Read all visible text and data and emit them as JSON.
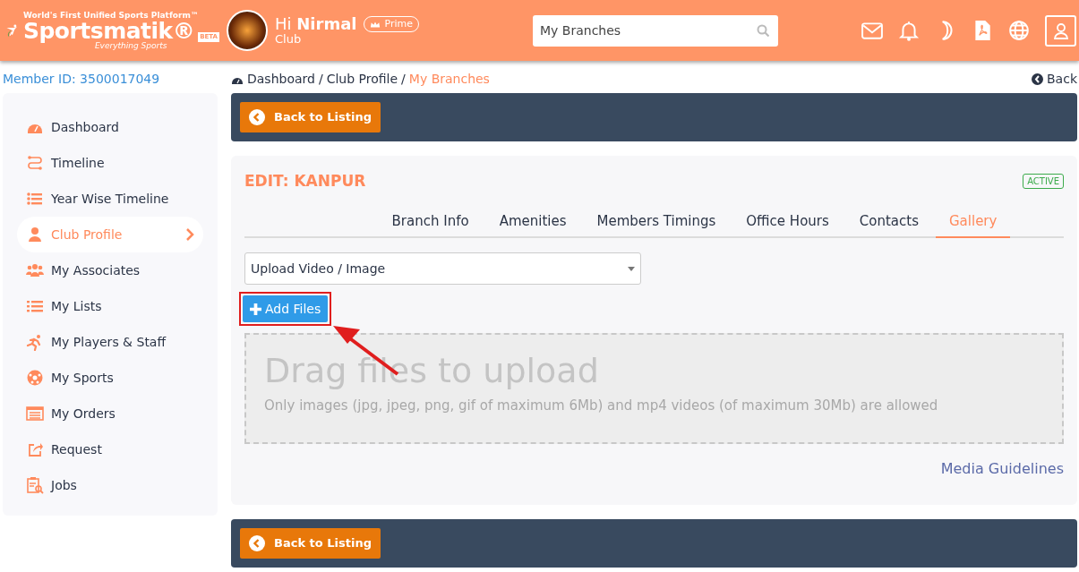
{
  "header": {
    "logo": {
      "tagline_top": "World's First Unified Sports Platform™",
      "brand": "Sportsmatik®",
      "beta": "BETA",
      "tagline_bottom": "Everything Sports"
    },
    "greeting": "Hi **Nirmal**",
    "badge": "Prime",
    "role": "Club",
    "search": {
      "value": "My Branches"
    }
  },
  "member_id": "Member ID: 3500017049",
  "breadcrumb": {
    "separator": "/",
    "items": [
      {
        "label": "Dashboard",
        "current": false
      },
      {
        "label": "Club Profile",
        "current": false
      },
      {
        "label": "My Branches",
        "current": true
      }
    ]
  },
  "back": "Back",
  "sidebar": {
    "items": [
      {
        "label": "Dashboard",
        "selected": false
      },
      {
        "label": "Timeline",
        "selected": false
      },
      {
        "label": "Year Wise Timeline",
        "selected": false
      },
      {
        "label": "Club Profile",
        "selected": true
      },
      {
        "label": "My Associates",
        "selected": false
      },
      {
        "label": "My Lists",
        "selected": false
      },
      {
        "label": "My Players & Staff",
        "selected": false
      },
      {
        "label": "My Sports",
        "selected": false
      },
      {
        "label": "My Orders",
        "selected": false
      },
      {
        "label": "Request",
        "selected": false
      },
      {
        "label": "Jobs",
        "selected": false
      }
    ]
  },
  "top_bar": {
    "button": "Back to Listing"
  },
  "edit_card": {
    "title": "EDIT: KANPUR",
    "status": "ACTIVE",
    "tabs": [
      {
        "label": "Branch Info",
        "selected": false
      },
      {
        "label": "Amenities",
        "selected": false
      },
      {
        "label": "Members Timings",
        "selected": false
      },
      {
        "label": "Office Hours",
        "selected": false
      },
      {
        "label": "Contacts",
        "selected": false
      },
      {
        "label": "Gallery",
        "selected": true
      }
    ],
    "select": {
      "value": "Upload Video / Image"
    },
    "add_button": "Add Files",
    "dropzone": {
      "title": "Drag files to upload",
      "hint": "Only images (jpg, jpeg, png, gif of maximum 6Mb) and mp4 videos (of maximum 30Mb) are allowed"
    },
    "link": "Media Guidelines"
  },
  "bottom_bar": {
    "button": "Back to Listing"
  }
}
